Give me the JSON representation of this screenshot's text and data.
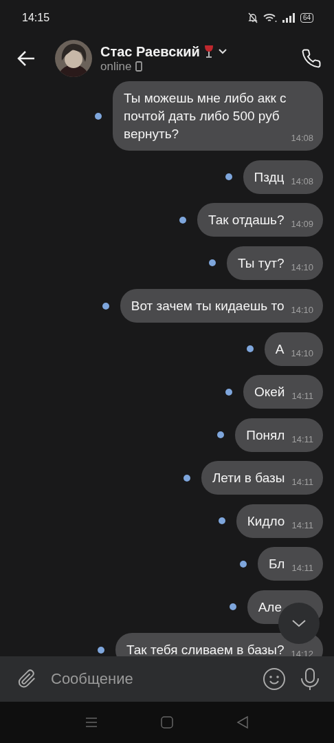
{
  "status_bar": {
    "time": "14:15",
    "battery": "64"
  },
  "header": {
    "name": "Стас Раевский",
    "status": "online"
  },
  "messages": [
    {
      "text": "Ты можешь мне либо акк с почтой дать либо 500 руб вернуть?",
      "time": "14:08",
      "unread": true
    },
    {
      "text": "Пздц",
      "time": "14:08",
      "unread": true
    },
    {
      "text": "Так отдашь?",
      "time": "14:09",
      "unread": true
    },
    {
      "text": "Ты тут?",
      "time": "14:10",
      "unread": true
    },
    {
      "text": "Вот зачем ты кидаешь то",
      "time": "14:10",
      "unread": true
    },
    {
      "text": "А",
      "time": "14:10",
      "unread": true
    },
    {
      "text": "Окей",
      "time": "14:11",
      "unread": true
    },
    {
      "text": "Понял",
      "time": "14:11",
      "unread": true
    },
    {
      "text": "Лети в базы",
      "time": "14:11",
      "unread": true
    },
    {
      "text": "Кидло",
      "time": "14:11",
      "unread": true
    },
    {
      "text": "Бл",
      "time": "14:11",
      "unread": true
    },
    {
      "text": "Але",
      "unread": true
    },
    {
      "text": "Так тебя сливаем в базы?",
      "time": "14:12",
      "unread": true
    }
  ],
  "composer": {
    "placeholder": "Сообщение"
  }
}
